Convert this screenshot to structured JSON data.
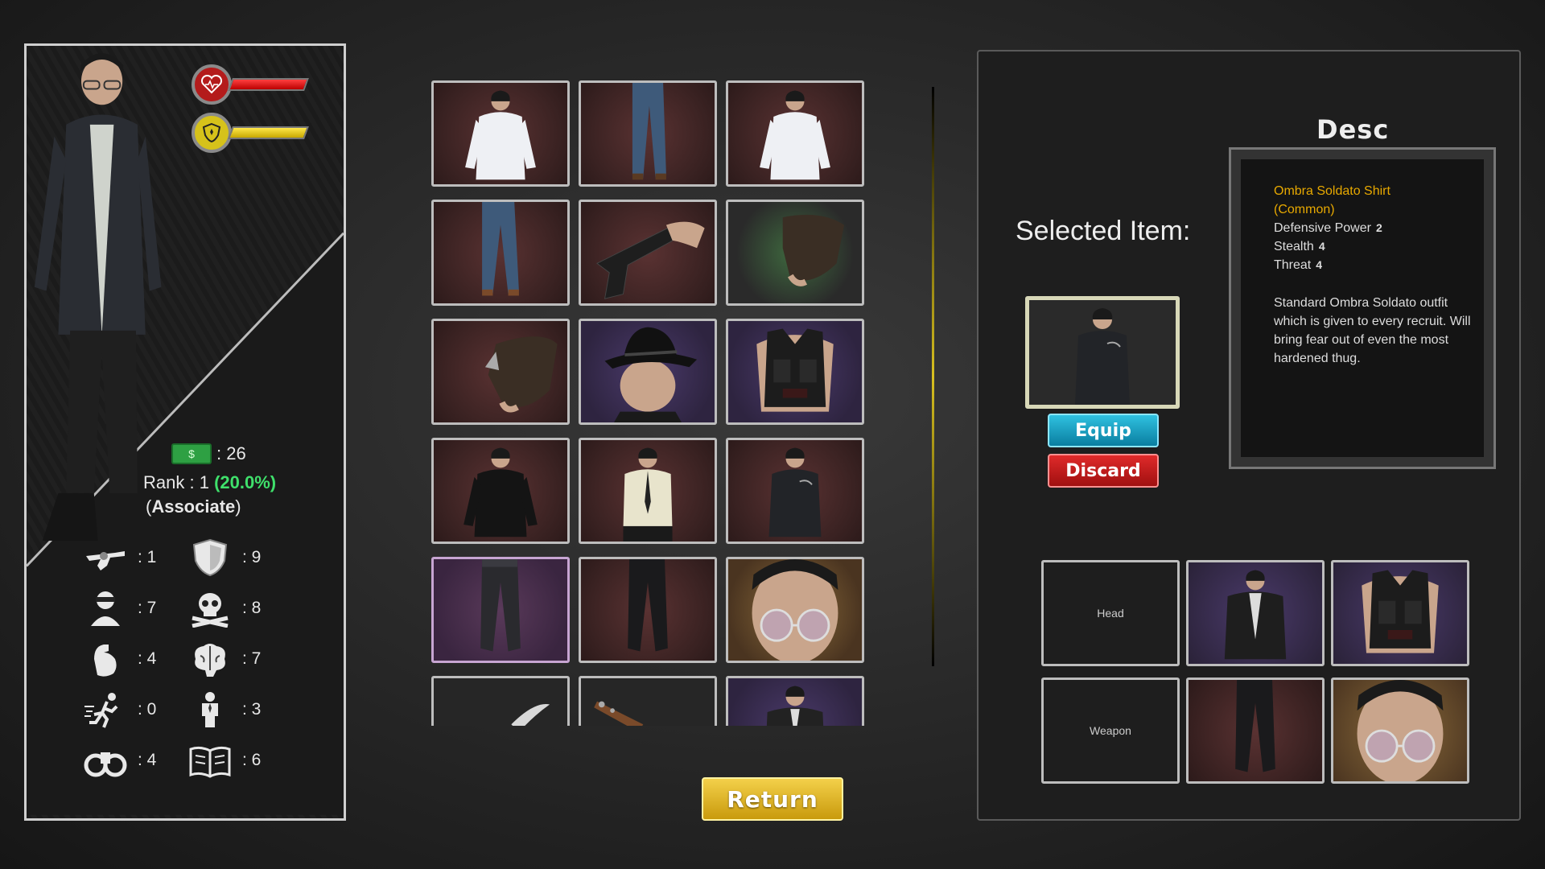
{
  "player": {
    "health_pct": 100,
    "defense_pct": 100,
    "money": ": 26",
    "rank_prefix": "Rank :",
    "rank_level": "1",
    "rank_pct": "(20.0%)",
    "rank_title_open": "(",
    "rank_title": "Associate",
    "rank_title_close": ")",
    "cash_symbol": "$",
    "stats": [
      {
        "icon": "revolver-icon",
        "value": ": 1"
      },
      {
        "icon": "shield-icon",
        "value": ": 9"
      },
      {
        "icon": "masked-thief-icon",
        "value": ": 7"
      },
      {
        "icon": "skull-icon",
        "value": ": 8"
      },
      {
        "icon": "bicep-icon",
        "value": ": 4"
      },
      {
        "icon": "brain-icon",
        "value": ": 7"
      },
      {
        "icon": "running-man-icon",
        "value": ": 0"
      },
      {
        "icon": "gentleman-icon",
        "value": ": 3"
      },
      {
        "icon": "binoculars-icon",
        "value": ": 4"
      },
      {
        "icon": "book-icon",
        "value": ": 6"
      }
    ]
  },
  "inventory": [
    {
      "item": "white-shirt"
    },
    {
      "item": "jeans"
    },
    {
      "item": "white-shirt"
    },
    {
      "item": "jeans"
    },
    {
      "item": "pistol"
    },
    {
      "item": "fingerless-glove"
    },
    {
      "item": "knuckle-glove"
    },
    {
      "item": "fedora-hat"
    },
    {
      "item": "body-armor-vest"
    },
    {
      "item": "black-shirt"
    },
    {
      "item": "cream-shirt"
    },
    {
      "item": "ombra-soldato-shirt"
    },
    {
      "item": "dark-trousers"
    },
    {
      "item": "black-trousers"
    },
    {
      "item": "glasses"
    },
    {
      "item": "knife"
    },
    {
      "item": "bat"
    },
    {
      "item": "jacket"
    }
  ],
  "buttons": {
    "return": "Return",
    "equip": "Equip",
    "discard": "Discard"
  },
  "selected": {
    "label": "Selected Item:",
    "desc_title": "Desc",
    "name": "Ombra Soldato Shirt",
    "rarity": "(Common)",
    "stats": [
      {
        "label": "Defensive Power",
        "value": "2"
      },
      {
        "label": "Stealth",
        "value": "4"
      },
      {
        "label": "Threat",
        "value": "4"
      }
    ],
    "description": "Standard Ombra Soldato outfit which is given to every recruit. Will bring fear out of even the most hardened thug."
  },
  "equipment": {
    "head_label": "Head",
    "weapon_label": "Weapon"
  },
  "colors": {
    "rank_pct": "#3fe06b",
    "item_name": "#e8a900",
    "return_btn": "#e0b420",
    "equip_btn": "#1ea6c8",
    "discard_btn": "#c81a1a"
  }
}
